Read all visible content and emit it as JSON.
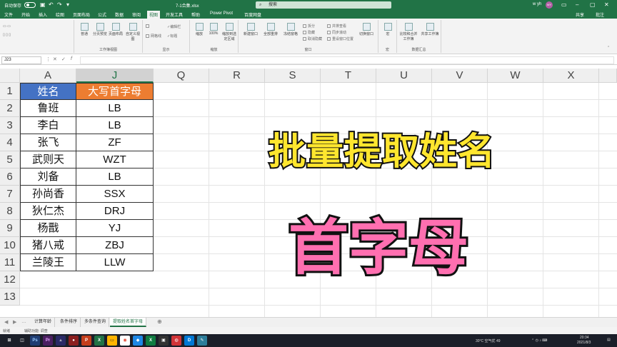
{
  "titlebar": {
    "autosave_label": "自动保存",
    "autosave_state": "关",
    "filename": "7-1合集.xlsx",
    "search_placeholder": "搜索",
    "user": "w yh",
    "avatar_initials": "WY"
  },
  "tabs": [
    "文件",
    "开始",
    "插入",
    "绘图",
    "页面布局",
    "公式",
    "数据",
    "审阅",
    "视图",
    "开发工具",
    "帮助",
    "Power Pivot",
    "百度网盘"
  ],
  "active_tab": "视图",
  "share_label": "共享",
  "comment_label": "批注",
  "ribbon": {
    "groups": [
      "工作簿视图",
      "显示",
      "缩放",
      "窗口",
      "宏",
      "数据汇总"
    ],
    "buttons": [
      "普通",
      "分页预览",
      "页面布局",
      "自定义视图",
      "缩放",
      "100%",
      "缩放到选定区域",
      "新建窗口",
      "全部重排",
      "冻结窗格",
      "切换窗口",
      "宏",
      "比较和合并工作簿",
      "共享工作簿"
    ],
    "small": [
      "网格线",
      "标题",
      "编辑栏",
      "拆分",
      "隐藏",
      "取消隐藏",
      "并排查看",
      "同步滚动",
      "重设窗口位置"
    ]
  },
  "formula_bar": {
    "name_box": "J23",
    "value": ""
  },
  "columns": [
    "A",
    "J",
    "Q",
    "R",
    "S",
    "T",
    "U",
    "V",
    "W",
    "X"
  ],
  "rows": [
    "1",
    "2",
    "3",
    "4",
    "5",
    "6",
    "7",
    "8",
    "9",
    "10",
    "11",
    "12",
    "13"
  ],
  "table": {
    "header_a": "姓名",
    "header_j": "大写首字母",
    "rows": [
      {
        "name": "鲁班",
        "initials": "LB"
      },
      {
        "name": "李白",
        "initials": "LB"
      },
      {
        "name": "张飞",
        "initials": "ZF"
      },
      {
        "name": "武则天",
        "initials": "WZT"
      },
      {
        "name": "刘备",
        "initials": "LB"
      },
      {
        "name": "孙尚香",
        "initials": "SSX"
      },
      {
        "name": "狄仁杰",
        "initials": "DRJ"
      },
      {
        "name": "杨戬",
        "initials": "YJ"
      },
      {
        "name": "猪八戒",
        "initials": "ZBJ"
      },
      {
        "name": "兰陵王",
        "initials": "LLW"
      }
    ]
  },
  "overlay": {
    "line1": "批量提取姓名",
    "line2": "首字母",
    "line1_color": "#ffe62e",
    "line2_color": "#ff6fb0"
  },
  "sheets": [
    "计算年龄",
    "条件排序",
    "多条件查询",
    "提取姓名首字母"
  ],
  "active_sheet": "提取姓名首字母",
  "status": {
    "ready": "就绪",
    "accessibility": "辅助功能: 调查"
  },
  "taskbar": {
    "weather": "30°C 空气优 49",
    "time": "20:34",
    "date": "2021/8/3"
  }
}
